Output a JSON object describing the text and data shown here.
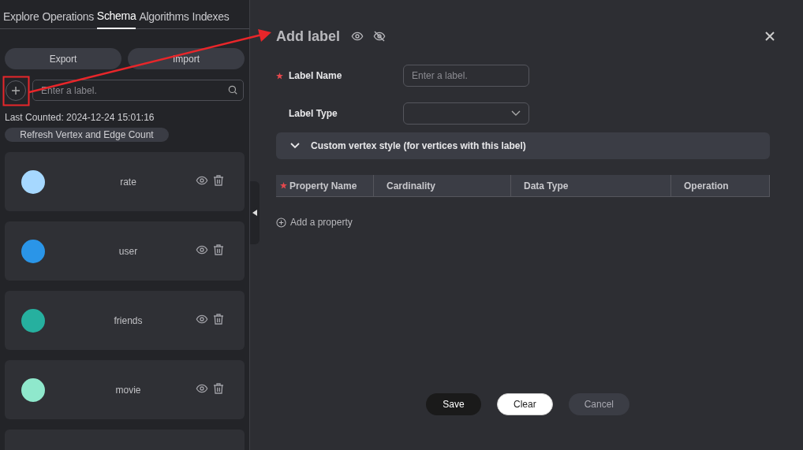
{
  "sidebar": {
    "tabs": [
      {
        "label": "Explore",
        "selected": false
      },
      {
        "label": "Operations",
        "selected": false
      },
      {
        "label": "Schema",
        "selected": true
      },
      {
        "label": "Algorithms",
        "selected": false
      },
      {
        "label": "Indexes",
        "selected": false
      }
    ],
    "buttons": [
      "Export",
      "Import"
    ],
    "search": {
      "placeholder": "Enter a label."
    },
    "last_counted": "Last Counted: 2024-12-24 15:01:16",
    "refresh_button": "Refresh Vertex and Edge Count",
    "labels": [
      {
        "kind": "full",
        "name": "rate",
        "color": "#a6d8ff"
      },
      {
        "kind": "full",
        "name": "user",
        "color": "#2a95e8"
      },
      {
        "kind": "full",
        "name": "friends",
        "color": "#26b09f"
      },
      {
        "kind": "full",
        "name": "movie",
        "color": "#8fe8cc"
      },
      {
        "kind": "partial"
      }
    ]
  },
  "dialog": {
    "title": "Add label",
    "fields": [
      {
        "kind": "input",
        "label": "Label Name",
        "required": true,
        "placeholder": "Enter a label."
      },
      {
        "kind": "select",
        "label": "Label Type"
      }
    ],
    "section": {
      "title": "Custom vertex style (for vertices with this label)",
      "expanded": false
    },
    "table": {
      "columns": [
        {
          "label": "Property Name",
          "required": true
        },
        {
          "label": "Cardinality",
          "required": false
        },
        {
          "label": "Data Type",
          "required": false
        },
        {
          "label": "Operation",
          "required": false
        }
      ]
    },
    "add_property": "Add a property",
    "buttons": [
      {
        "kind": "primary",
        "label": "Save"
      },
      {
        "kind": "light",
        "label": "Clear"
      },
      {
        "kind": "muted",
        "label": "Cancel"
      }
    ]
  }
}
